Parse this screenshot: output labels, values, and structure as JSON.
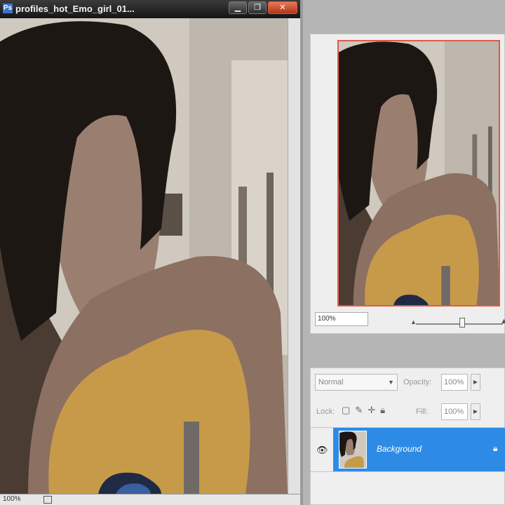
{
  "document": {
    "title": "profiles_hot_Emo_girl_01...",
    "zoom": "100%"
  },
  "window_buttons": {
    "minimize": "▁",
    "maximize": "❐",
    "close": "✕"
  },
  "navigator": {
    "zoom": "100%"
  },
  "layers": {
    "blend_mode": "Normal",
    "opacity_label": "Opacity:",
    "opacity": "100%",
    "lock_label": "Lock:",
    "fill_label": "Fill:",
    "fill": "100%",
    "items": [
      {
        "name": "Background",
        "visible": true,
        "locked": true
      }
    ]
  },
  "colors": {
    "selection_blue": "#2d8be6",
    "navigator_frame": "#e05a4a"
  }
}
